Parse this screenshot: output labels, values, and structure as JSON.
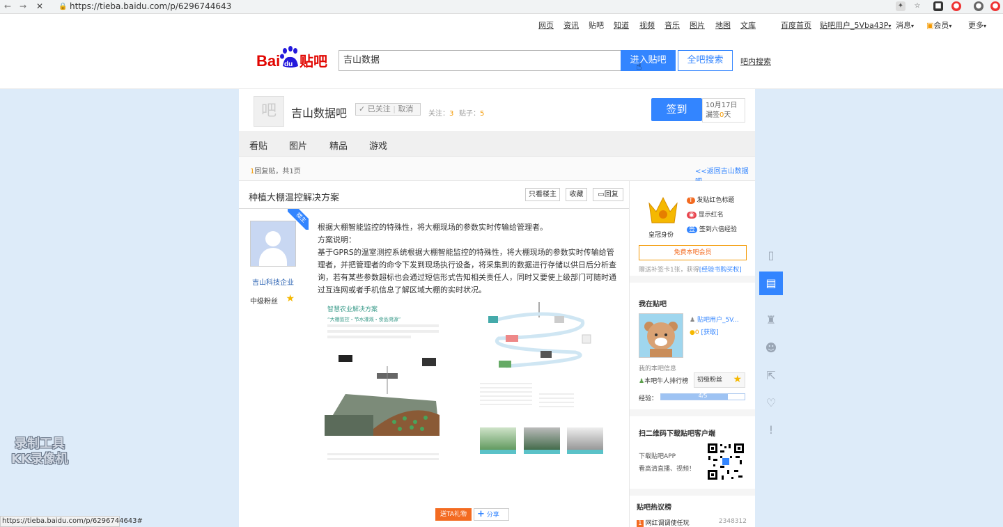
{
  "browser": {
    "url": "https://tieba.baidu.com/p/6296744643"
  },
  "toplinks": {
    "items": [
      "网页",
      "资讯",
      "贴吧",
      "知道",
      "视频",
      "音乐",
      "图片",
      "地图",
      "文库"
    ],
    "baidu_home": "百度首页",
    "user": "贴吧用户_5Vba43P",
    "messages": "消息",
    "vip": "会员",
    "more": "更多"
  },
  "header": {
    "logo_text_bai": "Bai",
    "logo_text_du": "du",
    "logo_text_tieba": "贴吧",
    "search_value": "吉山数据",
    "enter_button": "进入贴吧",
    "all_search_button": "全吧搜索",
    "in_bar_search": "吧内搜索"
  },
  "forum": {
    "name": "吉山数据吧",
    "followed_label": "已关注",
    "unfollow_label": "取消",
    "follow_count_label": "关注：",
    "follow_count": "3",
    "post_count_label": "贴子：",
    "post_count": "5",
    "sign_button": "签到",
    "sign_date": "10月17日",
    "sign_missed_label": "漏签",
    "sign_missed": "0",
    "sign_missed_unit": "天"
  },
  "tabs": [
    "看贴",
    "图片",
    "精品",
    "游戏"
  ],
  "page_info": {
    "reply_count": "1",
    "reply_label": "回复贴，共",
    "pages": "1",
    "pages_label": "页",
    "back_link": "<<返回吉山数据吧"
  },
  "post": {
    "title": "种植大棚温控解决方案",
    "only_author": "只看楼主",
    "collect": "收藏",
    "reply": "回复",
    "author_badge": "楼主",
    "author_name": "吉山科技企业",
    "author_level": "中级粉丝",
    "paragraphs": [
      "根据大棚智能监控的特殊性，将大棚现场的参数实时传输给管理者。",
      "方案说明：",
      "基于GPRS的温室测控系统根据大棚智能监控的特殊性，将大棚现场的参数实时传输给管理者，并把管理者的命令下发到现场执行设备，将采集到的数据进行存储以供日后分析查询，若有某些参数超标也会通过短信形式告知相关责任人，同时又要使上级部门可随时通过互连网或者手机信息了解区域大棚的实时状况。"
    ],
    "image_title": "智慧农业解决方案",
    "image_subtitle": "“大棚监控・节水灌溉・食品溯源”",
    "gift_button": "送TA礼物",
    "share_button": "分享"
  },
  "sidebar": {
    "crown_label": "皇冠身份",
    "perk1": "发贴红色标题",
    "perk2": "显示红名",
    "perk3": "签到六倍经验",
    "vip_button": "免费本吧会员",
    "gift_note": "赠送补签卡1张，获得",
    "gift_link": "[经验书购买权]",
    "my_bar_title": "我在贴吧",
    "my_user": "贴吧用户_5V...",
    "my_coins": "0",
    "my_get": "[获取]",
    "my_info_label": "我的本吧信息",
    "rank_label": "本吧牛人排行榜",
    "my_level": "初级粉丝",
    "exp_label": "经验：",
    "exp_value": "4/5",
    "exp_fraction": 0.8,
    "qr_title": "扫二维码下载贴吧客户端",
    "qr_line1": "下载贴吧APP",
    "qr_line2": "看高清直播、视频！",
    "hot_title": "贴吧热议榜",
    "hot_rank": "1",
    "hot_item": "网红调调使任玩",
    "hot_count": "2348312"
  },
  "watermark": {
    "line1": "录制工具",
    "line2": "KK录像机"
  },
  "statusbar": {
    "text": "https://tieba.baidu.com/p/6296744643#"
  },
  "colors": {
    "accent": "#3385ff",
    "page_bg": "#ddebf9",
    "highlight": "#f39800"
  }
}
